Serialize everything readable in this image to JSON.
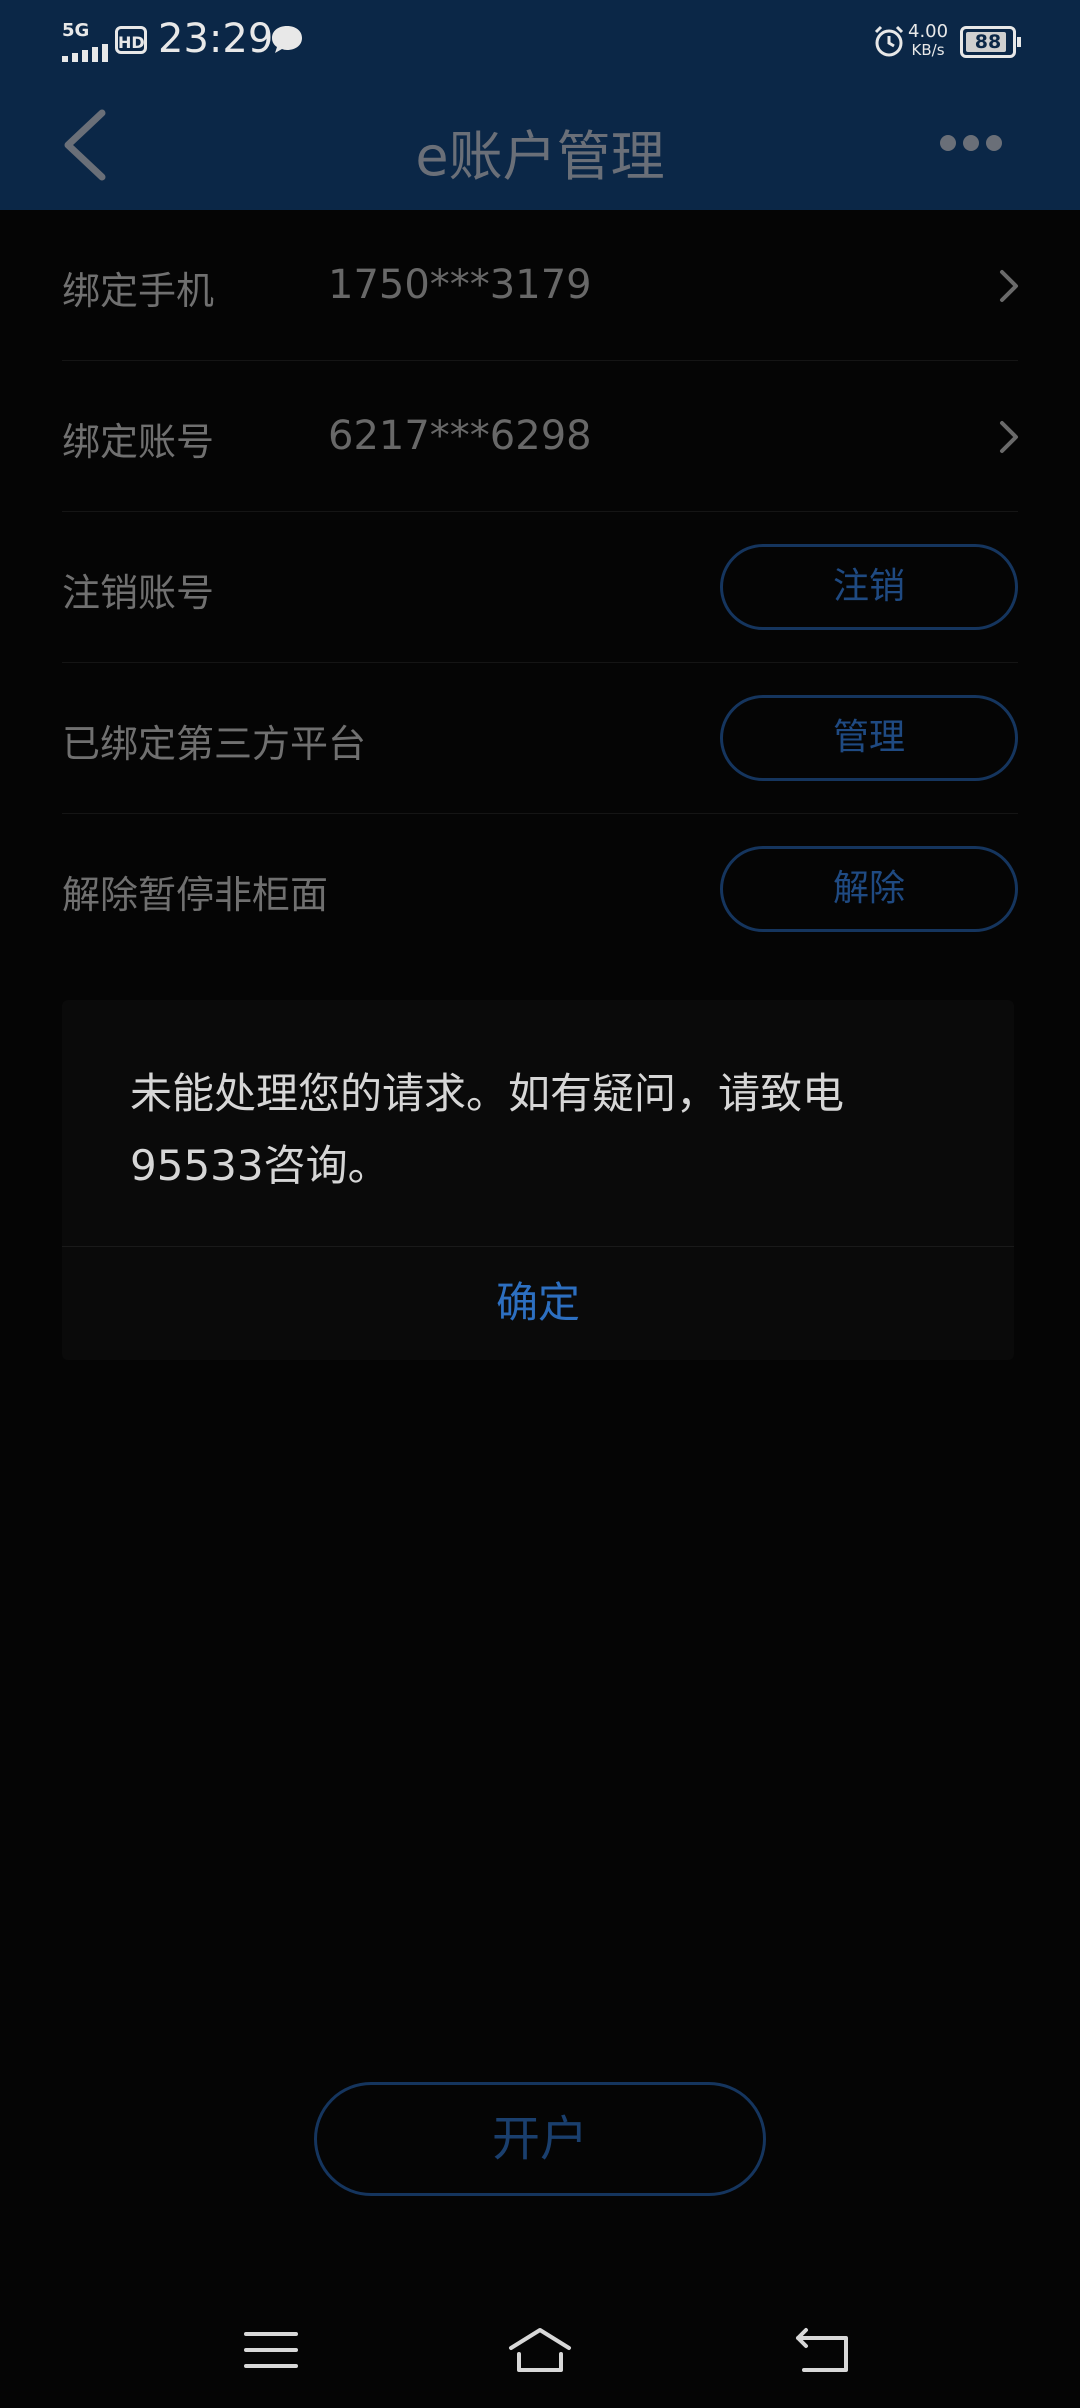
{
  "status_bar": {
    "network": "5G",
    "hd": "HD",
    "time": "23:29",
    "speed_value": "4.00",
    "speed_unit": "KB/s",
    "battery": "88"
  },
  "header": {
    "title": "e账户管理",
    "back_icon": "chevron-left-icon",
    "more_icon": "more-horizontal-icon"
  },
  "rows": [
    {
      "label": "绑定手机",
      "value": "1750***3179"
    },
    {
      "label": "绑定账号",
      "value": "6217***6298"
    },
    {
      "label": "注销账号",
      "button": "注销"
    },
    {
      "label": "已绑定第三方平台",
      "button": "管理"
    },
    {
      "label": "解除暂停非柜面",
      "button": "解除"
    }
  ],
  "dialog": {
    "message": "未能处理您的请求。如有疑问，请致电95533咨询。",
    "confirm": "确定"
  },
  "open_account": "开户",
  "colors": {
    "header_bg": "#0b2747",
    "accent": "#2d6fc0",
    "page_bg": "#050505"
  },
  "nav_icons": [
    "menu-icon",
    "home-icon",
    "back-icon"
  ]
}
